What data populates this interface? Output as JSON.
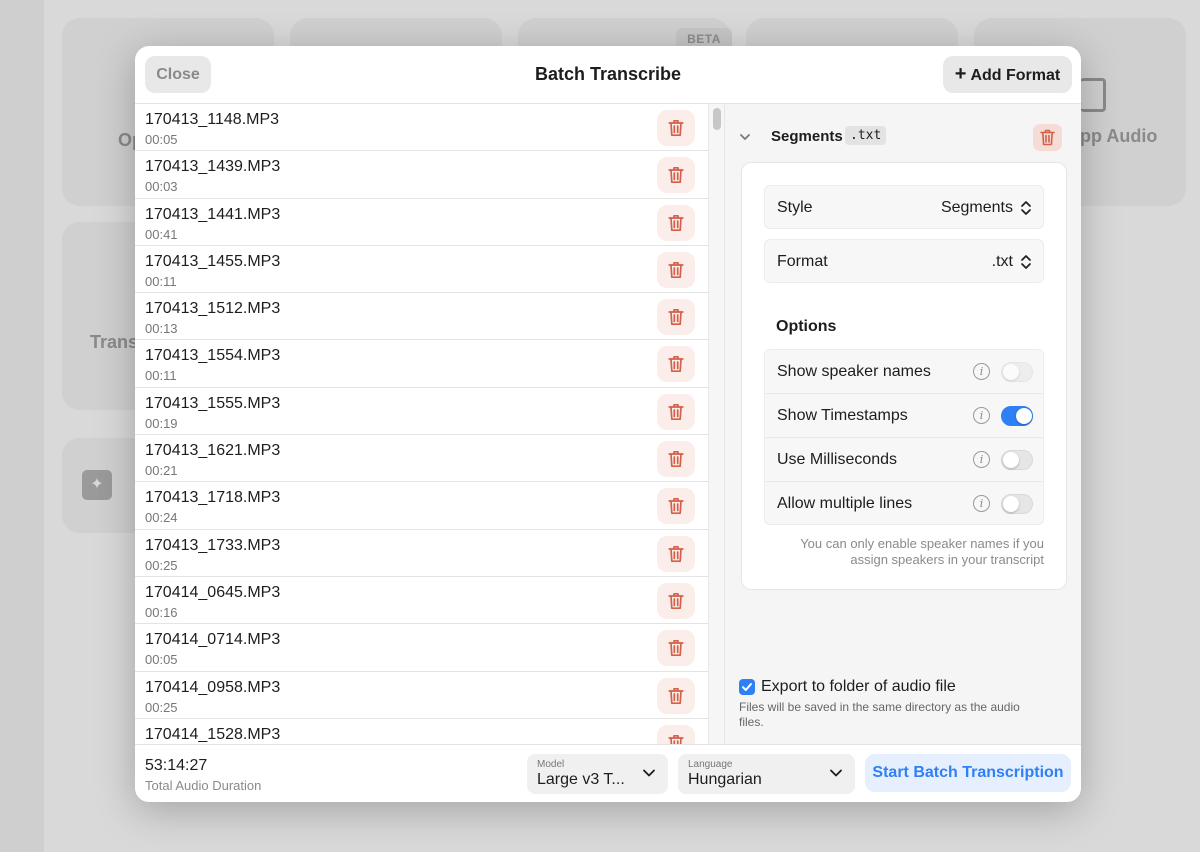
{
  "background": {
    "beta_badge": "BETA",
    "card_texts": [
      "Op",
      "pp Audio",
      "Trans"
    ]
  },
  "modal": {
    "close_label": "Close",
    "title": "Batch Transcribe",
    "add_format_label": "Add Format"
  },
  "files": [
    {
      "name": "170413_1148.MP3",
      "duration": "00:05"
    },
    {
      "name": "170413_1439.MP3",
      "duration": "00:03"
    },
    {
      "name": "170413_1441.MP3",
      "duration": "00:41"
    },
    {
      "name": "170413_1455.MP3",
      "duration": "00:11"
    },
    {
      "name": "170413_1512.MP3",
      "duration": "00:13"
    },
    {
      "name": "170413_1554.MP3",
      "duration": "00:11"
    },
    {
      "name": "170413_1555.MP3",
      "duration": "00:19"
    },
    {
      "name": "170413_1621.MP3",
      "duration": "00:21"
    },
    {
      "name": "170413_1718.MP3",
      "duration": "00:24"
    },
    {
      "name": "170413_1733.MP3",
      "duration": "00:25"
    },
    {
      "name": "170414_0645.MP3",
      "duration": "00:16"
    },
    {
      "name": "170414_0714.MP3",
      "duration": "00:05"
    },
    {
      "name": "170414_0958.MP3",
      "duration": "00:25"
    },
    {
      "name": "170414_1528.MP3",
      "duration": ""
    }
  ],
  "format_panel": {
    "title": "Segments",
    "extension": ".txt",
    "style_label": "Style",
    "style_value": "Segments",
    "format_label": "Format",
    "format_value": ".txt",
    "options_title": "Options",
    "options": [
      {
        "label": "Show speaker names",
        "enabled": false,
        "disabled": true
      },
      {
        "label": "Show Timestamps",
        "enabled": true,
        "disabled": false
      },
      {
        "label": "Use Milliseconds",
        "enabled": false,
        "disabled": false
      },
      {
        "label": "Allow multiple lines",
        "enabled": false,
        "disabled": false
      }
    ],
    "options_note": "You can only enable speaker names if you assign speakers in your transcript",
    "export_label": "Export to folder of audio file",
    "export_checked": true,
    "export_note": "Files will be saved in the same directory as the audio files."
  },
  "footer": {
    "total_duration": "53:14:27",
    "total_label": "Total Audio Duration",
    "model_label": "Model",
    "model_value": "Large v3 T...",
    "language_label": "Language",
    "language_value": "Hungarian",
    "start_label": "Start Batch Transcription"
  },
  "colors": {
    "accent": "#2f7ff5",
    "trash": "#d4604a",
    "trash_bg": "#fbeeea"
  }
}
